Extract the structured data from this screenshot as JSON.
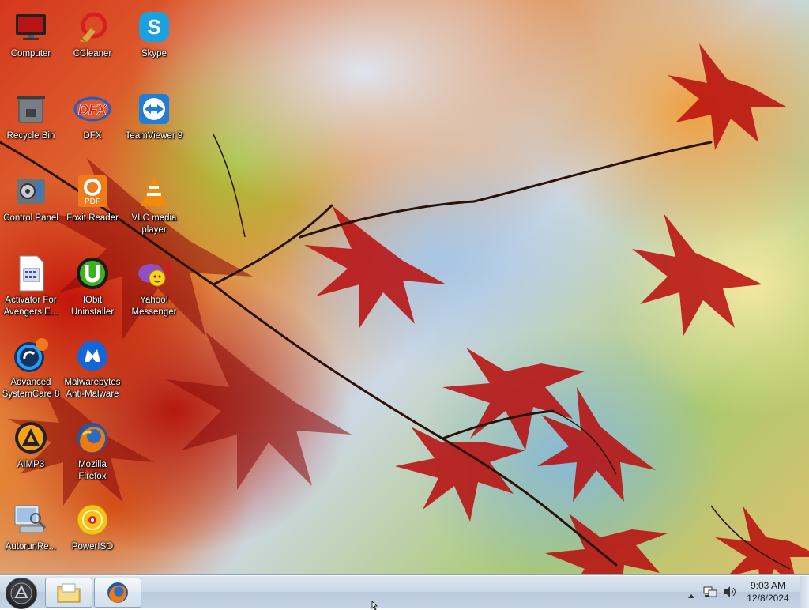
{
  "desktop": {
    "icons": [
      {
        "label": "Computer",
        "icon": "computer-icon"
      },
      {
        "label": "CCleaner",
        "icon": "ccleaner-icon"
      },
      {
        "label": "Skype",
        "icon": "skype-icon"
      },
      {
        "label": "Recycle Bin",
        "icon": "recycle-bin-icon"
      },
      {
        "label": "DFX",
        "icon": "dfx-icon"
      },
      {
        "label": "TeamViewer 9",
        "icon": "teamviewer-icon"
      },
      {
        "label": "Control Panel",
        "icon": "control-panel-icon"
      },
      {
        "label": "Foxit Reader",
        "icon": "foxit-reader-icon"
      },
      {
        "label": "VLC media\nplayer",
        "icon": "vlc-icon"
      },
      {
        "label": "Activator For\nAvengers E...",
        "icon": "activator-icon"
      },
      {
        "label": "IObit\nUninstaller",
        "icon": "iobit-uninstaller-icon"
      },
      {
        "label": "Yahoo!\nMessenger",
        "icon": "yahoo-messenger-icon"
      },
      {
        "label": "Advanced\nSystemCare 8",
        "icon": "advanced-systemcare-icon"
      },
      {
        "label": "Malwarebytes\nAnti-Malware",
        "icon": "malwarebytes-icon"
      },
      {
        "label": "AIMP3",
        "icon": "aimp-icon"
      },
      {
        "label": "Mozilla\nFirefox",
        "icon": "firefox-icon"
      },
      {
        "label": "AutorunRe...",
        "icon": "autorun-icon"
      },
      {
        "label": "PowerISO",
        "icon": "poweriso-icon"
      }
    ],
    "icon_text": {
      "dfx": "DFX",
      "foxit": "PDF"
    }
  },
  "taskbar": {
    "start_icon": "start-orb-icon",
    "pinned": [
      {
        "icon": "file-explorer-icon"
      },
      {
        "icon": "firefox-icon"
      }
    ],
    "tray": {
      "show_hidden_icon": "chevron-up-icon",
      "network_icon": "network-icon",
      "volume_icon": "speaker-icon"
    },
    "clock": {
      "time": "9:03 AM",
      "date": "12/8/2024"
    }
  },
  "colors": {
    "accent": "#1e90ff",
    "taskbar": "#c8d6e6"
  }
}
